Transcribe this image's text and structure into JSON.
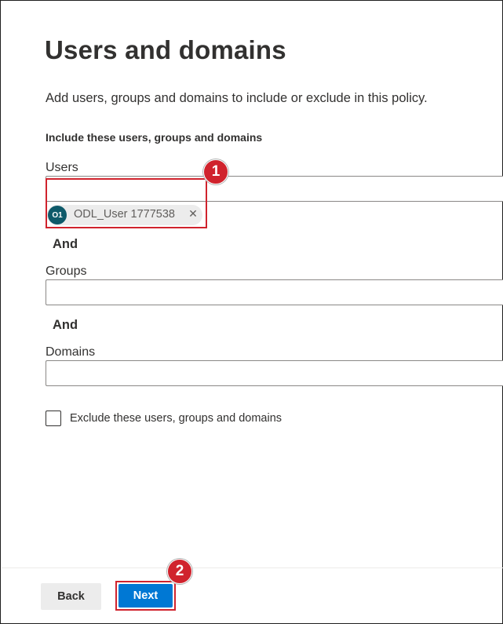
{
  "page": {
    "title": "Users and domains",
    "description": "Add users, groups and domains to include or exclude in this policy.",
    "section_heading": "Include these users, groups and domains"
  },
  "users": {
    "label": "Users",
    "value": "",
    "selected": [
      {
        "initials": "O1",
        "name": "ODL_User 1777538",
        "remove_symbol": "✕"
      }
    ]
  },
  "and_label_1": "And",
  "groups": {
    "label": "Groups",
    "value": ""
  },
  "and_label_2": "And",
  "domains": {
    "label": "Domains",
    "value": ""
  },
  "exclude": {
    "label": "Exclude these users, groups and domains",
    "checked": false
  },
  "footer": {
    "back_label": "Back",
    "next_label": "Next"
  },
  "annotations": {
    "badge_1": "1",
    "badge_2": "2"
  },
  "colors": {
    "accent": "#0078d4",
    "annotation": "#d0232d",
    "avatar": "#0f5a6a",
    "chip": "#ececec"
  }
}
